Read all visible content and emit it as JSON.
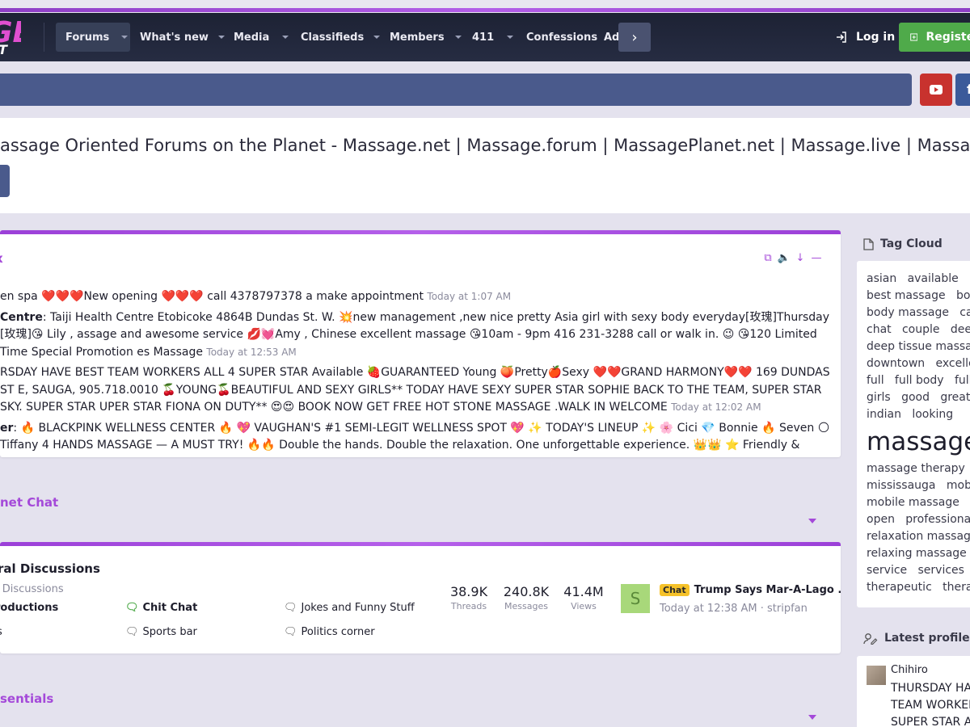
{
  "brand": {
    "logo_top": "GE",
    "logo_bottom": "T"
  },
  "nav": {
    "tabs": [
      {
        "label": "Forums"
      },
      {
        "label": "What's new"
      },
      {
        "label": "Media"
      },
      {
        "label": "Classifieds"
      },
      {
        "label": "Members"
      },
      {
        "label": "411"
      },
      {
        "label": "Confessions"
      },
      {
        "label": "Ads"
      }
    ],
    "login": "Log in",
    "register": "Register"
  },
  "social": {
    "facebook": "f"
  },
  "notice": {
    "text": "assage Oriented Forums on the Planet - Massage.net | Massage.forum | MassagePlanet.net | Massage.live | Massage"
  },
  "new_posts": {
    "title": "x",
    "posts": [
      {
        "who": "",
        "text": "en spa ❤️❤️❤️New opening ❤️❤️❤️ call 4378797378 a make appointment",
        "time": "Today at 1:07 AM"
      },
      {
        "who": "Centre",
        "text": ": Taiji Health Centre Etobicoke 4864B Dundas St. W. 💥new management ,new nice pretty Asia girl with sexy body everyday[玫瑰]Thursday [玫瑰]😘 Lily , assage and awesome service 💋💓Amy , Chinese excellent massage 😘10am - 9pm 416 231-3288 call or walk in. 😉 😘120 Limited Time Special Promotion es Massage",
        "time": "Today at 12:53 AM"
      },
      {
        "who": "",
        "text": "RSDAY HAVE BEST TEAM WORKERS ALL 4 SUPER STAR Available 🍓GUARANTEED Young 🍑Pretty🍎Sexy ❤️❤️GRAND HARMONY❤️❤️ 169 DUNDAS ST E, SAUGA, 905.718.0010 🍒YOUNG🍒BEAUTIFUL AND SEXY GIRLS** TODAY HAVE SEXY SUPER STAR SOPHIE BACK TO THE TEAM, SUPER STAR SKY. SUPER STAR UPER STAR FIONA ON DUTY** 😍😍 BOOK NOW GET FREE HOT STONE MASSAGE .WALK IN WELCOME",
        "time": "Today at 12:02 AM"
      },
      {
        "who": "er",
        "text": ": 🔥 BLACKPINK WELLNESS CENTER 🔥 💖 VAUGHAN'S #1 SEMI-LEGIT WELLNESS SPOT 💖 ✨ TODAY'S LINEUP ✨ 🌸 Cici 💎 Bonnie 🔥 Seven 🌕 Tiffany 4 HANDS MASSAGE — A MUST TRY! 🔥🔥 Double the hands. Double the relaxation. One unforgettable experience. 👑👑 ⭐ Friendly & welcoming",
        "time": ""
      }
    ]
  },
  "category1": {
    "title": "net Chat"
  },
  "forum": {
    "title": "ral Discussions",
    "subtitle": "l Discussions",
    "subforums": [
      {
        "label": "roductions"
      },
      {
        "label": "Chit Chat"
      },
      {
        "label": "Jokes and Funny Stuff"
      },
      {
        "label": "s"
      },
      {
        "label": "Sports bar"
      },
      {
        "label": "Politics corner"
      }
    ],
    "stats": [
      {
        "value": "38.9K",
        "label": "Threads"
      },
      {
        "value": "240.8K",
        "label": "Messages"
      },
      {
        "value": "41.4M",
        "label": "Views"
      }
    ],
    "last": {
      "avatar_letter": "S",
      "badge": "Chat",
      "title": "Trump Says Mar-A-Lago ...",
      "meta": "Today at 12:38 AM · stripfan"
    }
  },
  "category2": {
    "title": "sentials"
  },
  "sidebar": {
    "tag_cloud_title": "Tag Cloud",
    "tag_lines": [
      "asian   available   be",
      "best massage   body",
      "body massage   call",
      "chat   couple   deep",
      "deep tissue massag",
      "downtown   exceller",
      "full   full body   full b",
      "girls   good   great",
      "indian   looking",
      "massage",
      "massage therapy   n",
      "mississauga   mobil",
      "mobile massage   n",
      "open   professional",
      "relaxation massage",
      "relaxing massage   r",
      "service   services   s",
      "therapeutic   therap"
    ],
    "profile_title": "Latest profile posts",
    "profile_name": "Chihiro",
    "profile_text": "THURSDAY HAVE BEST TEAM WORKERS ALL 4 SUPER STAR Available 🍓GU"
  }
}
